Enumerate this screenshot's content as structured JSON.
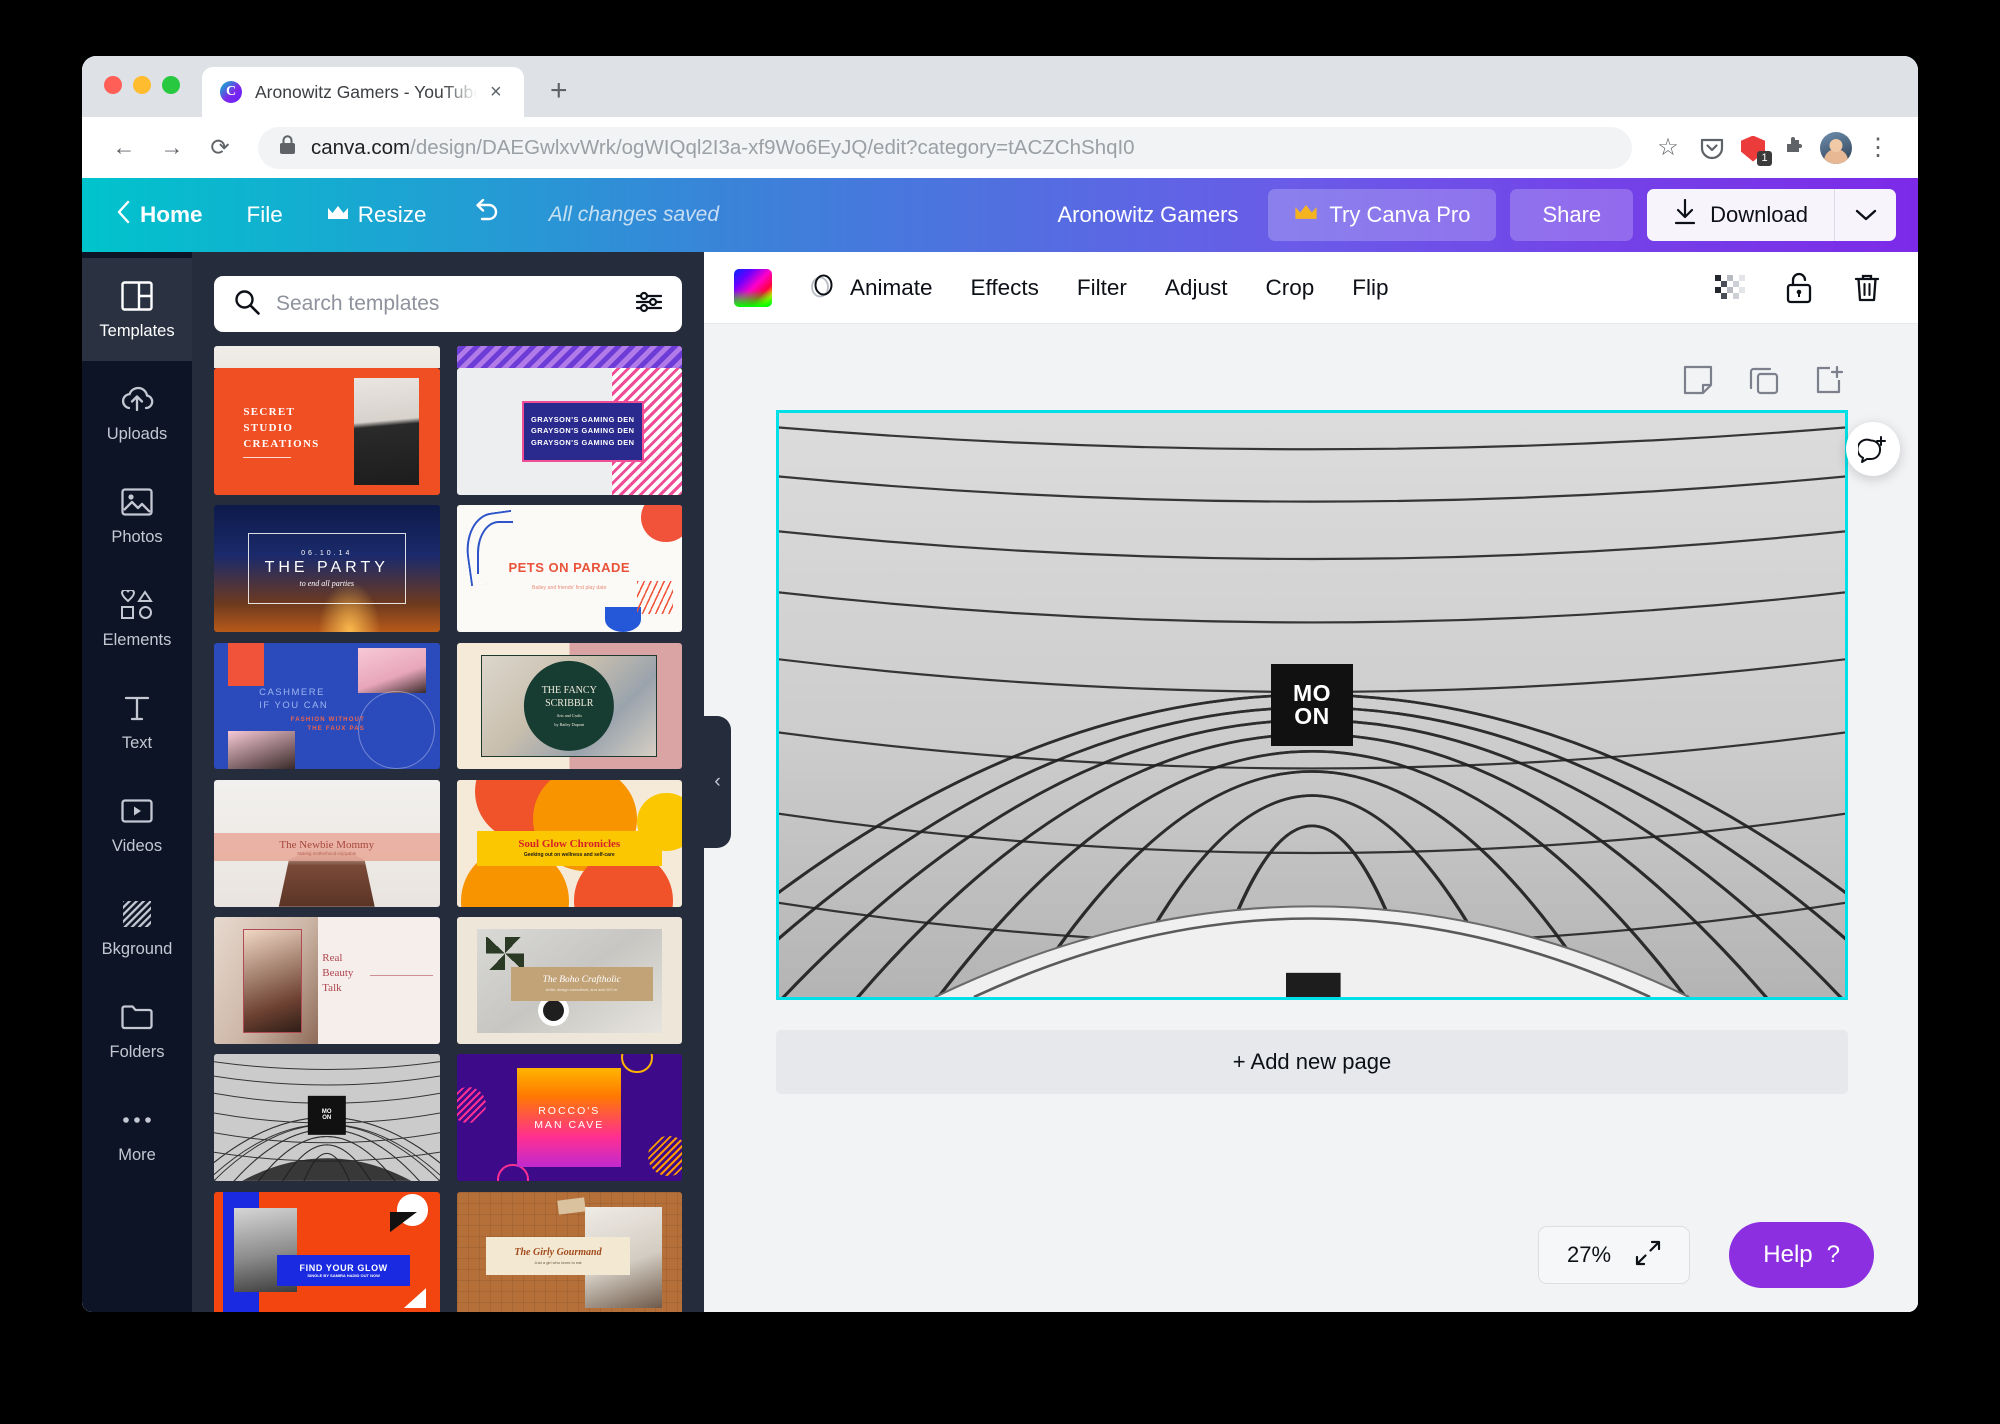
{
  "browser": {
    "tab_title": "Aronowitz Gamers - YouTube C",
    "favicon": "canva-logo-icon",
    "new_tab_label": "+",
    "close_label": "×",
    "url_host": "canva.com",
    "url_path": "/design/DAEGwlxvWrk/ogWIQql2I3a-xf9Wo6EyJQ/edit?category=tACZChShqI0",
    "back_glyph": "←",
    "forward_glyph": "→",
    "reload_glyph": "⟳",
    "bookmark_glyph": "☆",
    "extension_badge_count": "1",
    "menu_glyph": "⋮"
  },
  "topbar": {
    "home_label": "Home",
    "file_label": "File",
    "resize_label": "Resize",
    "undo_label": "undo-icon",
    "saved_status": "All changes saved",
    "design_title": "Aronowitz Gamers",
    "try_pro_label": "Try Canva Pro",
    "share_label": "Share",
    "download_label": "Download",
    "accent_start": "#00c4cc",
    "accent_end": "#7d2ae8"
  },
  "rail": {
    "items": [
      {
        "label": "Templates",
        "icon": "templates-icon",
        "active": true
      },
      {
        "label": "Uploads",
        "icon": "upload-cloud-icon",
        "active": false
      },
      {
        "label": "Photos",
        "icon": "photo-icon",
        "active": false
      },
      {
        "label": "Elements",
        "icon": "shapes-icon",
        "active": false
      },
      {
        "label": "Text",
        "icon": "text-icon",
        "active": false
      },
      {
        "label": "Videos",
        "icon": "video-icon",
        "active": false
      },
      {
        "label": "Bkground",
        "icon": "hatch-icon",
        "active": false
      },
      {
        "label": "Folders",
        "icon": "folder-icon",
        "active": false
      },
      {
        "label": "More",
        "icon": "ellipsis-icon",
        "active": false
      }
    ]
  },
  "templates_panel": {
    "search_placeholder": "Search templates",
    "search_value": "",
    "filter_icon": "sliders-icon",
    "collapse_glyph": "‹",
    "items": [
      {
        "name": "secret-studio-creations",
        "title_lines": [
          "SECRET",
          "STUDIO",
          "CREATIONS"
        ]
      },
      {
        "name": "graysons-gaming-den",
        "title_lines": [
          "GRAYSON'S GAMING DEN",
          "GRAYSON'S GAMING DEN",
          "GRAYSON'S GAMING DEN"
        ]
      },
      {
        "name": "the-party",
        "date": "06.10.14",
        "title": "THE PARTY",
        "subtitle": "to end all parties"
      },
      {
        "name": "pets-on-parade",
        "title": "PETS ON PARADE",
        "subtitle": "Bailey and friends' first play date"
      },
      {
        "name": "cashmere-if-you-can",
        "title_lines": [
          "CASHMERE",
          "IF YOU CAN"
        ],
        "subtitle_lines": [
          "FASHION WITHOUT",
          "THE FAUX PAS"
        ]
      },
      {
        "name": "the-fancy-scribblr",
        "title_lines": [
          "THE FANCY",
          "SCRIBBLR"
        ],
        "subtitle_lines": [
          "Arts and Crafts",
          "by Bailey Dupont"
        ]
      },
      {
        "name": "the-newbie-mommy",
        "title": "The Newbie Mommy",
        "subtitle": "Making motherhood enjoyable"
      },
      {
        "name": "soul-glow-chronicles",
        "title": "Soul Glow Chronicles",
        "subtitle": "Geeking out on wellness and self-care"
      },
      {
        "name": "real-beauty-talk",
        "title_lines": [
          "Real",
          "Beauty",
          "Talk"
        ]
      },
      {
        "name": "the-boho-craftholic",
        "title": "The Boho Craftholic",
        "subtitle": "Artist, design consultant, and avid DIY-er"
      },
      {
        "name": "moon-dome",
        "badge_lines": [
          "MO",
          "ON"
        ]
      },
      {
        "name": "roccos-man-cave",
        "title_lines": [
          "ROCCO'S",
          "MAN CAVE"
        ]
      },
      {
        "name": "find-your-glow",
        "title": "FIND YOUR GLOW",
        "subtitle": "SINGLE BY SAMIRA HADID OUT NOW"
      },
      {
        "name": "the-girly-gourmand",
        "title": "The Girly Gourmand",
        "subtitle": "Just a girl who loves to eat"
      }
    ]
  },
  "object_toolbar": {
    "color_swatch_label": "image-color-swatch",
    "animate_label": "Animate",
    "effects_label": "Effects",
    "filter_label": "Filter",
    "adjust_label": "Adjust",
    "crop_label": "Crop",
    "flip_label": "Flip",
    "transparency_icon": "checkerboard-transparency-icon",
    "lock_icon": "unlock-icon",
    "delete_icon": "trash-icon"
  },
  "page_actions": {
    "notes_icon": "sticky-note-icon",
    "duplicate_icon": "duplicate-icon",
    "add_page_icon": "add-page-icon",
    "comment_icon": "add-comment-icon"
  },
  "canvas": {
    "selected_element": "dome-photo",
    "selection_color": "#00e0e6",
    "overlay_logo_lines": [
      "MO",
      "ON"
    ],
    "add_new_page_label": "+ Add new page"
  },
  "footer": {
    "zoom_level": "27%",
    "fit_icon": "expand-icon",
    "help_label": "Help",
    "help_glyph": "?"
  }
}
